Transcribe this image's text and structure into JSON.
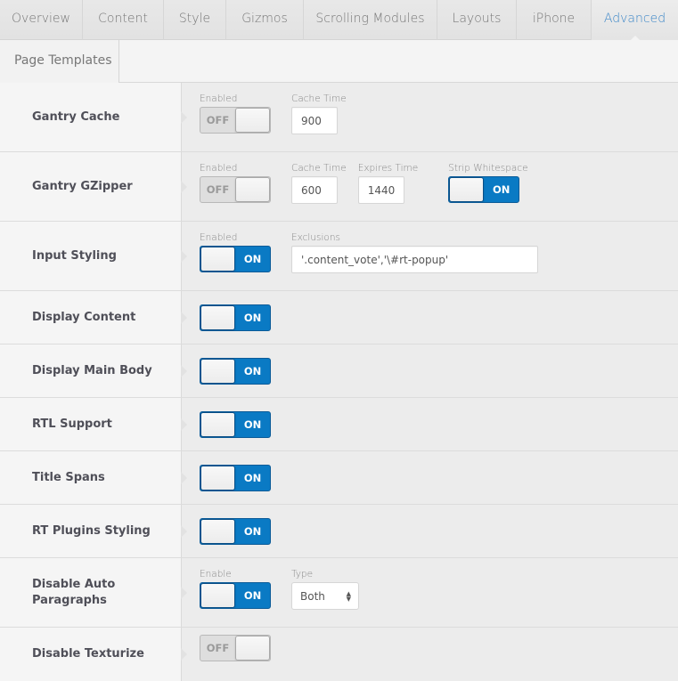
{
  "tabs": [
    {
      "label": "Overview",
      "active": false
    },
    {
      "label": "Content",
      "active": false
    },
    {
      "label": "Style",
      "active": false
    },
    {
      "label": "Gizmos",
      "active": false
    },
    {
      "label": "Scrolling Modules",
      "active": false
    },
    {
      "label": "Layouts",
      "active": false
    },
    {
      "label": "iPhone",
      "active": false
    },
    {
      "label": "Advanced",
      "active": true
    }
  ],
  "subtabs": [
    {
      "label": "Page Templates"
    }
  ],
  "accent_color": "#0a7ac4",
  "active_tab_color": "#3d87c8",
  "rows": {
    "gantry_cache": {
      "label": "Gantry Cache",
      "enabled_label": "Enabled",
      "enabled_state": "OFF",
      "cache_time_label": "Cache Time",
      "cache_time_value": "900"
    },
    "gantry_gzipper": {
      "label": "Gantry GZipper",
      "enabled_label": "Enabled",
      "enabled_state": "OFF",
      "cache_time_label": "Cache Time",
      "cache_time_value": "600",
      "expires_time_label": "Expires Time",
      "expires_time_value": "1440",
      "strip_whitespace_label": "Strip Whitespace",
      "strip_whitespace_state": "ON"
    },
    "input_styling": {
      "label": "Input Styling",
      "enabled_label": "Enabled",
      "enabled_state": "ON",
      "exclusions_label": "Exclusions",
      "exclusions_value": "'.content_vote','\\#rt-popup'"
    },
    "display_content": {
      "label": "Display Content",
      "state": "ON"
    },
    "display_main_body": {
      "label": "Display Main Body",
      "state": "ON"
    },
    "rtl_support": {
      "label": "RTL Support",
      "state": "ON"
    },
    "title_spans": {
      "label": "Title Spans",
      "state": "ON"
    },
    "rt_plugins_styling": {
      "label": "RT Plugins Styling",
      "state": "ON"
    },
    "disable_auto_paragraphs": {
      "label": "Disable Auto Paragraphs",
      "enable_label": "Enable",
      "enable_state": "ON",
      "type_label": "Type",
      "type_value": "Both"
    },
    "disable_texturize": {
      "label": "Disable Texturize",
      "state": "OFF"
    }
  }
}
